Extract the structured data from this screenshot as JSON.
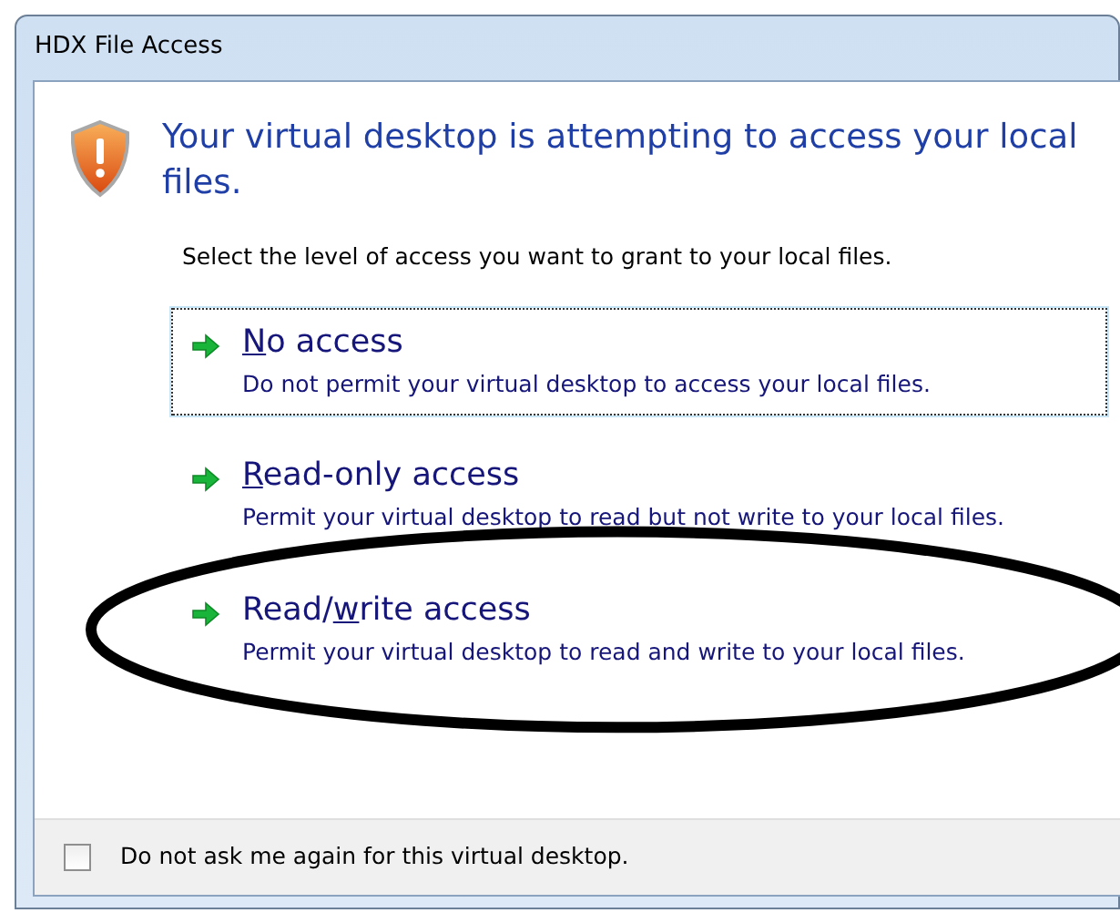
{
  "window": {
    "title": "HDX File Access"
  },
  "heading": "Your virtual desktop is attempting to access your local files.",
  "instruction": "Select the level of access you want to grant to your local files.",
  "options": [
    {
      "access_key": "N",
      "title_after": "o access",
      "description": "Do not permit your virtual desktop to access your local files.",
      "focused": true,
      "circled": false
    },
    {
      "access_key": "R",
      "title_after": "ead-only access",
      "description": "Permit your virtual desktop to read but not write to your local files.",
      "focused": false,
      "circled": false
    },
    {
      "title_before": "Read/",
      "access_key": "w",
      "title_after": "rite access",
      "description": "Permit your virtual desktop to read and write to your local files.",
      "focused": false,
      "circled": true
    }
  ],
  "footer": {
    "checkbox_label": "Do not ask me again for this virtual desktop.",
    "checked": false
  }
}
